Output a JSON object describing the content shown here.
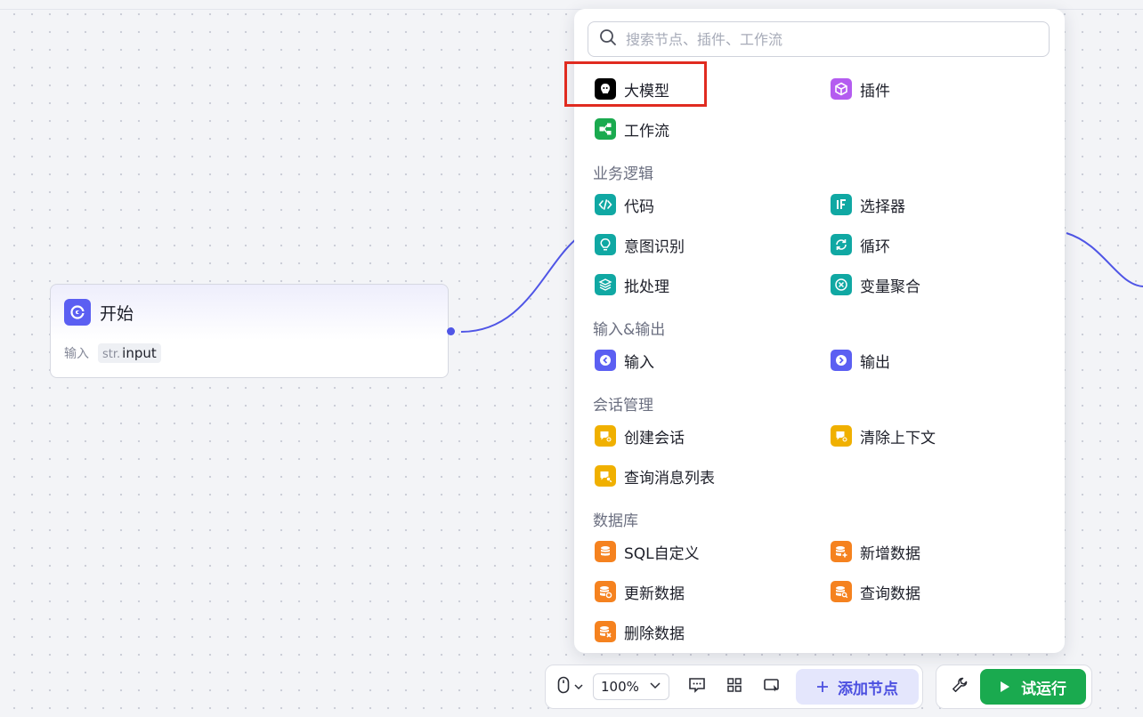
{
  "start_node": {
    "title": "开始",
    "input_label": "输入",
    "input_type": "str.",
    "input_name": "input"
  },
  "search": {
    "placeholder": "搜索节点、插件、工作流"
  },
  "top_items": [
    {
      "label": "大模型",
      "icon": "llm-icon",
      "color": "#000000"
    },
    {
      "label": "插件",
      "icon": "plugin-icon",
      "color": "#b45cf0"
    },
    {
      "label": "工作流",
      "icon": "workflow-icon",
      "color": "#1aaa4f"
    }
  ],
  "sections": [
    {
      "title": "业务逻辑",
      "items": [
        {
          "label": "代码",
          "icon": "code-icon",
          "color": "#10a8a3"
        },
        {
          "label": "选择器",
          "icon": "if-icon",
          "color": "#10a8a3"
        },
        {
          "label": "意图识别",
          "icon": "intent-icon",
          "color": "#10a8a3"
        },
        {
          "label": "循环",
          "icon": "loop-icon",
          "color": "#10a8a3"
        },
        {
          "label": "批处理",
          "icon": "batch-icon",
          "color": "#10a8a3"
        },
        {
          "label": "变量聚合",
          "icon": "variable-merge-icon",
          "color": "#10a8a3"
        }
      ]
    },
    {
      "title": "输入&输出",
      "items": [
        {
          "label": "输入",
          "icon": "input-icon",
          "color": "#5b5ff2"
        },
        {
          "label": "输出",
          "icon": "output-icon",
          "color": "#5b5ff2"
        }
      ]
    },
    {
      "title": "会话管理",
      "items": [
        {
          "label": "创建会话",
          "icon": "create-conversation-icon",
          "color": "#f0b000"
        },
        {
          "label": "清除上下文",
          "icon": "clear-context-icon",
          "color": "#f0b000"
        },
        {
          "label": "查询消息列表",
          "icon": "query-messages-icon",
          "color": "#f0b000"
        }
      ]
    },
    {
      "title": "数据库",
      "items": [
        {
          "label": "SQL自定义",
          "icon": "sql-database-icon",
          "color": "#f5821f"
        },
        {
          "label": "新增数据",
          "icon": "insert-data-icon",
          "color": "#f5821f"
        },
        {
          "label": "更新数据",
          "icon": "update-data-icon",
          "color": "#f5821f"
        },
        {
          "label": "查询数据",
          "icon": "query-data-icon",
          "color": "#f5821f"
        },
        {
          "label": "删除数据",
          "icon": "delete-data-icon",
          "color": "#f5821f"
        }
      ]
    }
  ],
  "toolbar": {
    "zoom": "100%",
    "add_node_label": "添加节点",
    "run_label": "试运行"
  },
  "colors": {
    "accent": "#4b4fe0",
    "edge": "#4f55e6",
    "run": "#1aaa4f",
    "highlight": "#e02b20"
  }
}
